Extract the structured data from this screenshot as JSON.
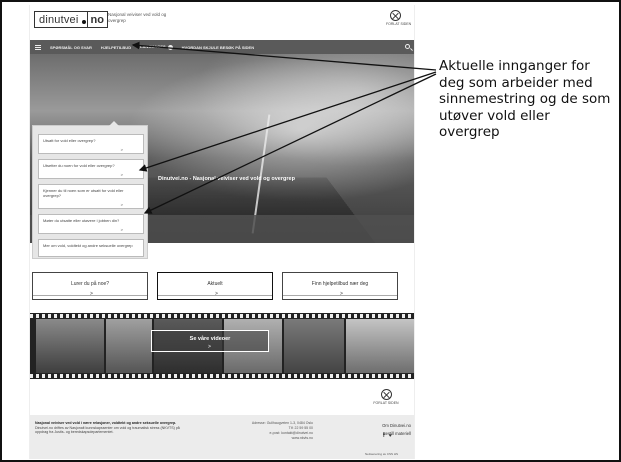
{
  "header": {
    "logo_part1": "dinutvei",
    "logo_part2": "no",
    "tagline": "Nasjonal veiviser ved vold og overgrep",
    "quit_label": "FORLAT SIDEN"
  },
  "nav": {
    "items": [
      {
        "label": "SPØRSMÅL OG SVAR"
      },
      {
        "label": "HJELPETILBUD"
      },
      {
        "label": "LANGUAGES"
      },
      {
        "label": "HVORDAN SKJULE BESØK PÅ SIDEN"
      }
    ]
  },
  "hero": {
    "banner_text": "Dinutvei.no - Nasjonal veiviser ved vold og overgrep"
  },
  "side_menu": {
    "items": [
      {
        "label": "Utsatt for vold eller overgrep?"
      },
      {
        "label": "Utsetter du noen for vold eller overgrep?"
      },
      {
        "label": "Kjenner du til noen som er utsatt for vold eller overgrep?"
      },
      {
        "label": "Møter du utsatte eller utøvere i jobben din?"
      },
      {
        "label": "Mer om vold, voldtekt og andre seksuelle overgrep"
      }
    ],
    "arrow": ">"
  },
  "buttons": [
    {
      "label": "Lurer du på noe?"
    },
    {
      "label": "Aktuelt"
    },
    {
      "label": "Finn hjelpetilbud nær deg"
    }
  ],
  "video": {
    "label": "Se våre videoer",
    "arrow": ">"
  },
  "footer": {
    "left_title": "Nasjonal veiviser ved vold i nære relasjoner, voldtekt og andre seksuelle overgrep.",
    "left_body": "Dinutvei.no driftes av Nasjonalt kunnskapssenter om vold og traumatisk stress (NKVTS) på oppdrag fra Justis- og beredskapsdepartementet.",
    "address": "Adresse: Gullhaugveien 1-3, 0484 Oslo",
    "phone": "Tlf: 22 59 55 00",
    "email": "e-post: kontakt@dinutvei.no",
    "url": "www.nkvts.no",
    "link_about": "Om Dinutvei.no",
    "link_order": "Bestill materiell",
    "social_fb": "f",
    "social_tw": "♥",
    "small": "Nettsenering av CSS HS"
  },
  "annotation": {
    "text": "Aktuelle innganger for deg som arbeider med sinnemestring og de som utøver vold eller overgrep"
  }
}
